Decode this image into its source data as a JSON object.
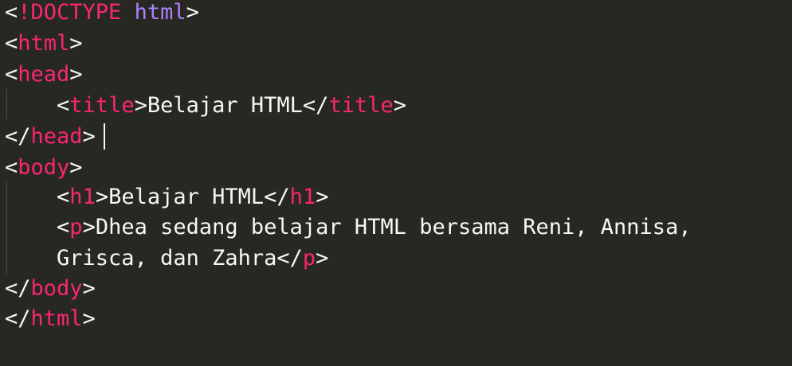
{
  "editor": {
    "theme": "monokai",
    "colors": {
      "background": "#272822",
      "tag": "#f92672",
      "doctype_keyword": "#ae81ff",
      "text": "#f8f8f2"
    },
    "lines": [
      {
        "open": "<",
        "doctype": "!DOCTYPE",
        "keyword": "html",
        "close": ">"
      },
      {
        "open": "<",
        "tag": "html",
        "close": ">"
      },
      {
        "open": "<",
        "tag": "head",
        "close": ">"
      },
      {
        "indent": "    ",
        "open": "<",
        "tag": "title",
        "close": ">",
        "text": "Belajar HTML",
        "open2": "</",
        "tag2": "title",
        "close2": ">"
      },
      {
        "open": "</",
        "tag": "head",
        "close": ">"
      },
      {
        "open": "<",
        "tag": "body",
        "close": ">"
      },
      {
        "indent": "    ",
        "open": "<",
        "tag": "h1",
        "close": ">",
        "text": "Belajar HTML",
        "open2": "</",
        "tag2": "h1",
        "close2": ">"
      },
      {
        "indent": "    ",
        "open": "<",
        "tag": "p",
        "close": ">",
        "text": "Dhea sedang belajar HTML bersama Reni, Annisa,"
      },
      {
        "indent": "    ",
        "text": "Grisca, dan Zahra",
        "open2": "</",
        "tag2": "p",
        "close2": ">"
      },
      {
        "open": "</",
        "tag": "body",
        "close": ">"
      },
      {
        "open": "</",
        "tag": "html",
        "close": ">"
      }
    ]
  }
}
